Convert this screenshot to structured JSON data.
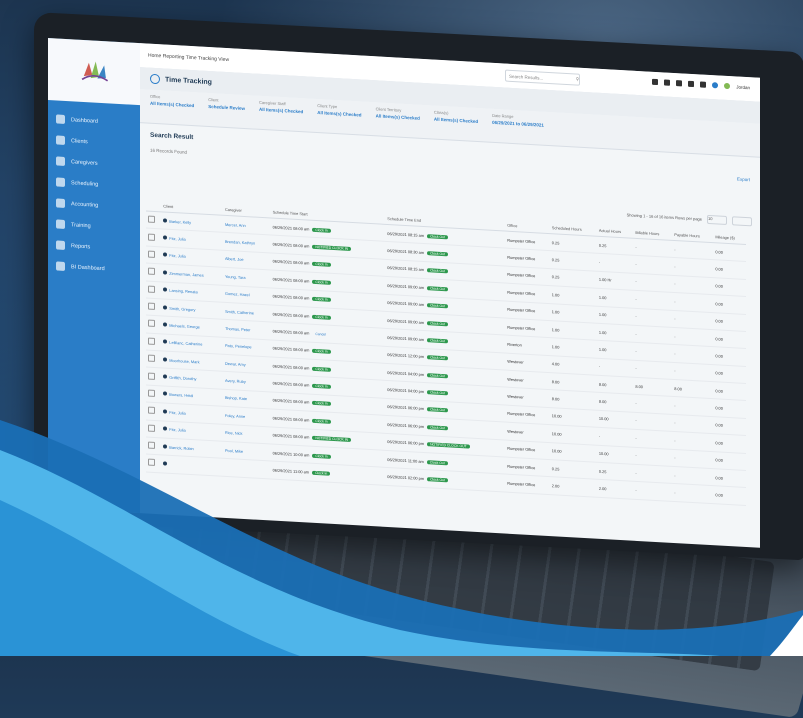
{
  "app": {
    "breadcrumb": "Home  Reporting  Time Tracking  View",
    "page_title": "Time Tracking",
    "search_placeholder": "Search Results...",
    "user_name": "Jordan",
    "search_result_title": "Search Result",
    "search_result_sub": "16 Records Found",
    "export_label": "Export",
    "pager_text": "Showing 1 - 16 of 16 items   Rows per page",
    "pager_size": "10"
  },
  "sidebar": {
    "items": [
      {
        "label": "Dashboard",
        "icon": "dashboard-icon"
      },
      {
        "label": "Clients",
        "icon": "clients-icon"
      },
      {
        "label": "Caregivers",
        "icon": "caregivers-icon"
      },
      {
        "label": "Scheduling",
        "icon": "scheduling-icon"
      },
      {
        "label": "Accounting",
        "icon": "accounting-icon"
      },
      {
        "label": "Training",
        "icon": "training-icon"
      },
      {
        "label": "Reports",
        "icon": "reports-icon"
      },
      {
        "label": "BI Dashboard",
        "icon": "bi-dashboard-icon"
      }
    ]
  },
  "filters": [
    {
      "label": "Office",
      "value": "All Items(s) Checked"
    },
    {
      "label": "Client",
      "value": "Schedule Review"
    },
    {
      "label": "Caregiver Staff",
      "value": "All Items(s) Checked"
    },
    {
      "label": "Client Type",
      "value": "All Items(s) Checked"
    },
    {
      "label": "Client Territory",
      "value": "All Items(s) Checked"
    },
    {
      "label": "Class(s)",
      "value": "All Items(s) Checked"
    },
    {
      "label": "Date Range",
      "value": "06/29/2021 to 06/29/2021"
    }
  ],
  "table": {
    "columns": [
      "",
      "Client",
      "Caregiver",
      "Schedule Time Start",
      "Schedule Time End",
      "Office",
      "Scheduled Hours",
      "Actual Hours",
      "Billable Hours",
      "Payable Hours",
      "Mileage ($)"
    ],
    "rows": [
      [
        "Barker, Kelly",
        "Mercer, Ann",
        "06/29/2021 08:00 am",
        "Clock In",
        "06/29/2021 08:15 am",
        "Clock Out",
        "Rumpster Office",
        "0.25",
        "0.25",
        "-",
        "-",
        "0.00"
      ],
      [
        "Fitz, Julia",
        "Brendan, Kathryn",
        "06/29/2021 08:00 am",
        "NOTIFIED CLOCK IN",
        "06/29/2021 08:30 am",
        "Clock Out",
        "Rumpster Office",
        "0.25",
        "-",
        "-",
        "-",
        "0.00"
      ],
      [
        "Fitz, Julia",
        "Albert, Joe",
        "06/29/2021 08:00 am",
        "Clock In",
        "06/29/2021 08:15 am",
        "Clock Out",
        "Rumpster Office",
        "0.25",
        "1.00 Hr",
        "-",
        "-",
        "0.00"
      ],
      [
        "Zimmerman, James",
        "Young, Tara",
        "06/29/2021 08:00 am",
        "Clock In",
        "06/29/2021 09:00 am",
        "Clock Out",
        "Rumpster Office",
        "1.00",
        "1.00",
        "-",
        "-",
        "0.00"
      ],
      [
        "Lansing, Renata",
        "Gomez, Hazel",
        "06/29/2021 08:00 am",
        "Clock In",
        "06/29/2021 09:00 am",
        "Clock Out",
        "Rumpster Office",
        "1.00",
        "1.00",
        "-",
        "-",
        "0.00"
      ],
      [
        "Smith, Gregory",
        "Smith, Catherine",
        "06/29/2021 08:00 am",
        "Clock In",
        "06/29/2021 09:00 am",
        "Clock Out",
        "Rumpster Office",
        "1.00",
        "1.00",
        "-",
        "-",
        "0.00"
      ],
      [
        "Michaels, George",
        "Thomas, Peter",
        "06/29/2021 08:00 am",
        "Cancel",
        "06/29/2021 09:00 am",
        "Clock Out",
        "Riverton",
        "1.00",
        "1.00",
        "-",
        "-",
        "0.00"
      ],
      [
        "LeBlanc, Catherine",
        "Pato, Penelope",
        "06/29/2021 08:00 am",
        "Clock In",
        "06/29/2021 12:00 pm",
        "Clock Out",
        "Westover",
        "4.00",
        "-",
        "-",
        "-",
        "0.00"
      ],
      [
        "Moorhouse, Mark",
        "Dewar, Amy",
        "06/29/2021 08:00 am",
        "Clock In",
        "06/29/2021 04:00 pm",
        "Clock Out",
        "Westover",
        "8.00",
        "8.00",
        "8.00",
        "8.00",
        "0.00"
      ],
      [
        "Griffith, Dorothy",
        "Avery, Ruby",
        "06/29/2021 08:00 am",
        "Clock In",
        "06/29/2021 04:00 pm",
        "Clock Out",
        "Westover",
        "8.00",
        "8.00",
        "-",
        "-",
        "0.00"
      ],
      [
        "Bowers, Heidi",
        "Bishop, Kate",
        "06/29/2021 08:00 am",
        "Clock In",
        "06/29/2021 06:00 pm",
        "Clock Out",
        "Rumpster Office",
        "10.00",
        "10.00",
        "-",
        "-",
        "0.00"
      ],
      [
        "Fitz, Julia",
        "Foley, Anne",
        "06/29/2021 08:00 am",
        "Clock In",
        "06/29/2021 06:00 pm",
        "Clock Out",
        "Westover",
        "10.00",
        "-",
        "-",
        "-",
        "0.00"
      ],
      [
        "Fitz, Julia",
        "Rice, Nick",
        "06/29/2021 08:00 am",
        "NOTIFIED CLOCK IN",
        "06/29/2021 06:00 pm",
        "NOTIFIED CLOCK OUT",
        "Rumpster Office",
        "10.00",
        "10.00",
        "-",
        "-",
        "0.00"
      ],
      [
        "Barrick, Robin",
        "Pool, Mike",
        "06/29/2021 10:00 am",
        "Clock In",
        "06/29/2021 11:00 am",
        "Clock Out",
        "Rumpster Office",
        "0.25",
        "0.25",
        "-",
        "-",
        "0.00"
      ],
      [
        "",
        "",
        "06/29/2021 11:00 am",
        "Clock In",
        "06/29/2021 02:00 pm",
        "Clock Out",
        "Rumpster Office",
        "2.00",
        "2.00",
        "-",
        "-",
        "0.00"
      ]
    ]
  },
  "colors": {
    "sidebar": "#1d7fd6",
    "accent": "#1e7fd8",
    "pill": "#1f9d45",
    "wave_light": "#4fb5ea",
    "wave_dark": "#1a6fb5"
  }
}
